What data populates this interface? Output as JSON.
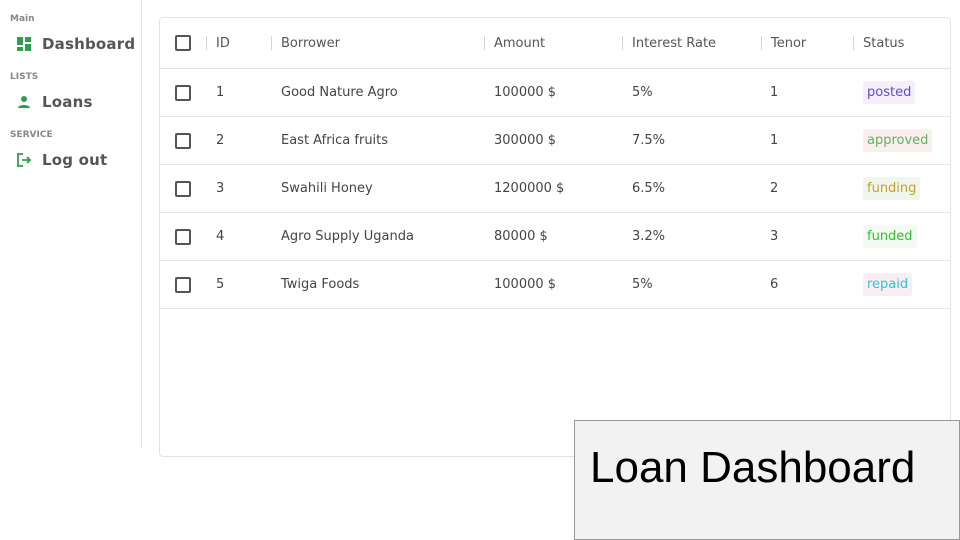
{
  "sidebar": {
    "sections": [
      {
        "title": "Main",
        "item": {
          "label": "Dashboard",
          "icon": "dashboard-icon"
        }
      },
      {
        "title": "LISTS",
        "item": {
          "label": "Loans",
          "icon": "person-icon"
        }
      },
      {
        "title": "SERVICE",
        "item": {
          "label": "Log out",
          "icon": "logout-icon"
        }
      }
    ],
    "accent": "#2e9e4f"
  },
  "table": {
    "headers": [
      "ID",
      "Borrower",
      "Amount",
      "Interest Rate",
      "Tenor",
      "Status"
    ],
    "rows": [
      {
        "id": "1",
        "borrower": "Good Nature Agro",
        "amount": "100000 $",
        "rate": "5%",
        "tenor": "1",
        "status": "posted"
      },
      {
        "id": "2",
        "borrower": "East Africa fruits",
        "amount": "300000 $",
        "rate": "7.5%",
        "tenor": "1",
        "status": "approved"
      },
      {
        "id": "3",
        "borrower": "Swahili Honey",
        "amount": "1200000 $",
        "rate": "6.5%",
        "tenor": "2",
        "status": "funding"
      },
      {
        "id": "4",
        "borrower": "Agro Supply Uganda",
        "amount": "80000 $",
        "rate": "3.2%",
        "tenor": "3",
        "status": "funded"
      },
      {
        "id": "5",
        "borrower": "Twiga Foods",
        "amount": "100000 $",
        "rate": "5%",
        "tenor": "6",
        "status": "repaid"
      }
    ],
    "status_colors": {
      "posted": {
        "text": "#5a4fcf",
        "bg": "#f6eef8"
      },
      "approved": {
        "text": "#5fb35f",
        "bg": "#fbeeee"
      },
      "funding": {
        "text": "#c9a227",
        "bg": "#eef6ee"
      },
      "funded": {
        "text": "#2fbf2f",
        "bg": "#f3faf3"
      },
      "repaid": {
        "text": "#28c8d8",
        "bg": "#fbeef3"
      }
    }
  },
  "caption": {
    "text": "Loan Dashboard"
  }
}
